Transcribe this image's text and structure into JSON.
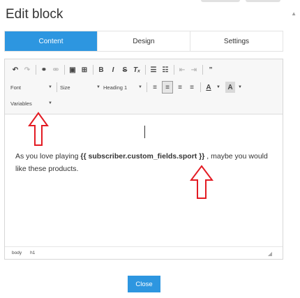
{
  "dialog": {
    "title": "Edit block",
    "tabs": [
      {
        "label": "Content",
        "active": true
      },
      {
        "label": "Design",
        "active": false
      },
      {
        "label": "Settings",
        "active": false
      }
    ],
    "close_label": "Close"
  },
  "toolbar": {
    "row1": [
      {
        "icon": "undo-icon",
        "glyph": "↶",
        "enabled": true
      },
      {
        "icon": "redo-icon",
        "glyph": "↷",
        "enabled": false
      },
      {
        "icon": "link-icon",
        "glyph": "⚭",
        "enabled": true
      },
      {
        "icon": "unlink-icon",
        "glyph": "⚮",
        "enabled": false
      },
      {
        "icon": "image-icon",
        "glyph": "▣",
        "enabled": true
      },
      {
        "icon": "table-icon",
        "glyph": "⊞",
        "enabled": true
      },
      {
        "icon": "bold-icon",
        "glyph": "B",
        "enabled": true
      },
      {
        "icon": "italic-icon",
        "glyph": "I",
        "enabled": true
      },
      {
        "icon": "strikethrough-icon",
        "glyph": "S",
        "enabled": true
      },
      {
        "icon": "remove-format-icon",
        "glyph": "Tₓ",
        "enabled": true
      },
      {
        "icon": "numbered-list-icon",
        "glyph": "☰",
        "enabled": true
      },
      {
        "icon": "bulleted-list-icon",
        "glyph": "☷",
        "enabled": true
      },
      {
        "icon": "outdent-icon",
        "glyph": "⇤",
        "enabled": false
      },
      {
        "icon": "indent-icon",
        "glyph": "⇥",
        "enabled": false
      },
      {
        "icon": "blockquote-icon",
        "glyph": "”",
        "enabled": true
      }
    ],
    "font_label": "Font",
    "size_label": "Size",
    "format_label": "Heading 1",
    "variables_label": "Variables",
    "align": [
      {
        "icon": "align-left-icon",
        "glyph": "≡",
        "active": false
      },
      {
        "icon": "align-center-icon",
        "glyph": "≡",
        "active": true
      },
      {
        "icon": "align-right-icon",
        "glyph": "≡",
        "active": false
      },
      {
        "icon": "align-justify-icon",
        "glyph": "≡",
        "active": false
      }
    ],
    "text_color_label": "A",
    "bg_color_label": "A"
  },
  "editor": {
    "text_before": "As you love playing ",
    "variable": "{{ subscriber.custom_fields.sport }}",
    "text_after": " , maybe you would like these products."
  },
  "statusbar": {
    "path": [
      "body",
      "h1"
    ]
  },
  "colors": {
    "accent": "#2d96e0",
    "arrow": "#e31b23"
  }
}
